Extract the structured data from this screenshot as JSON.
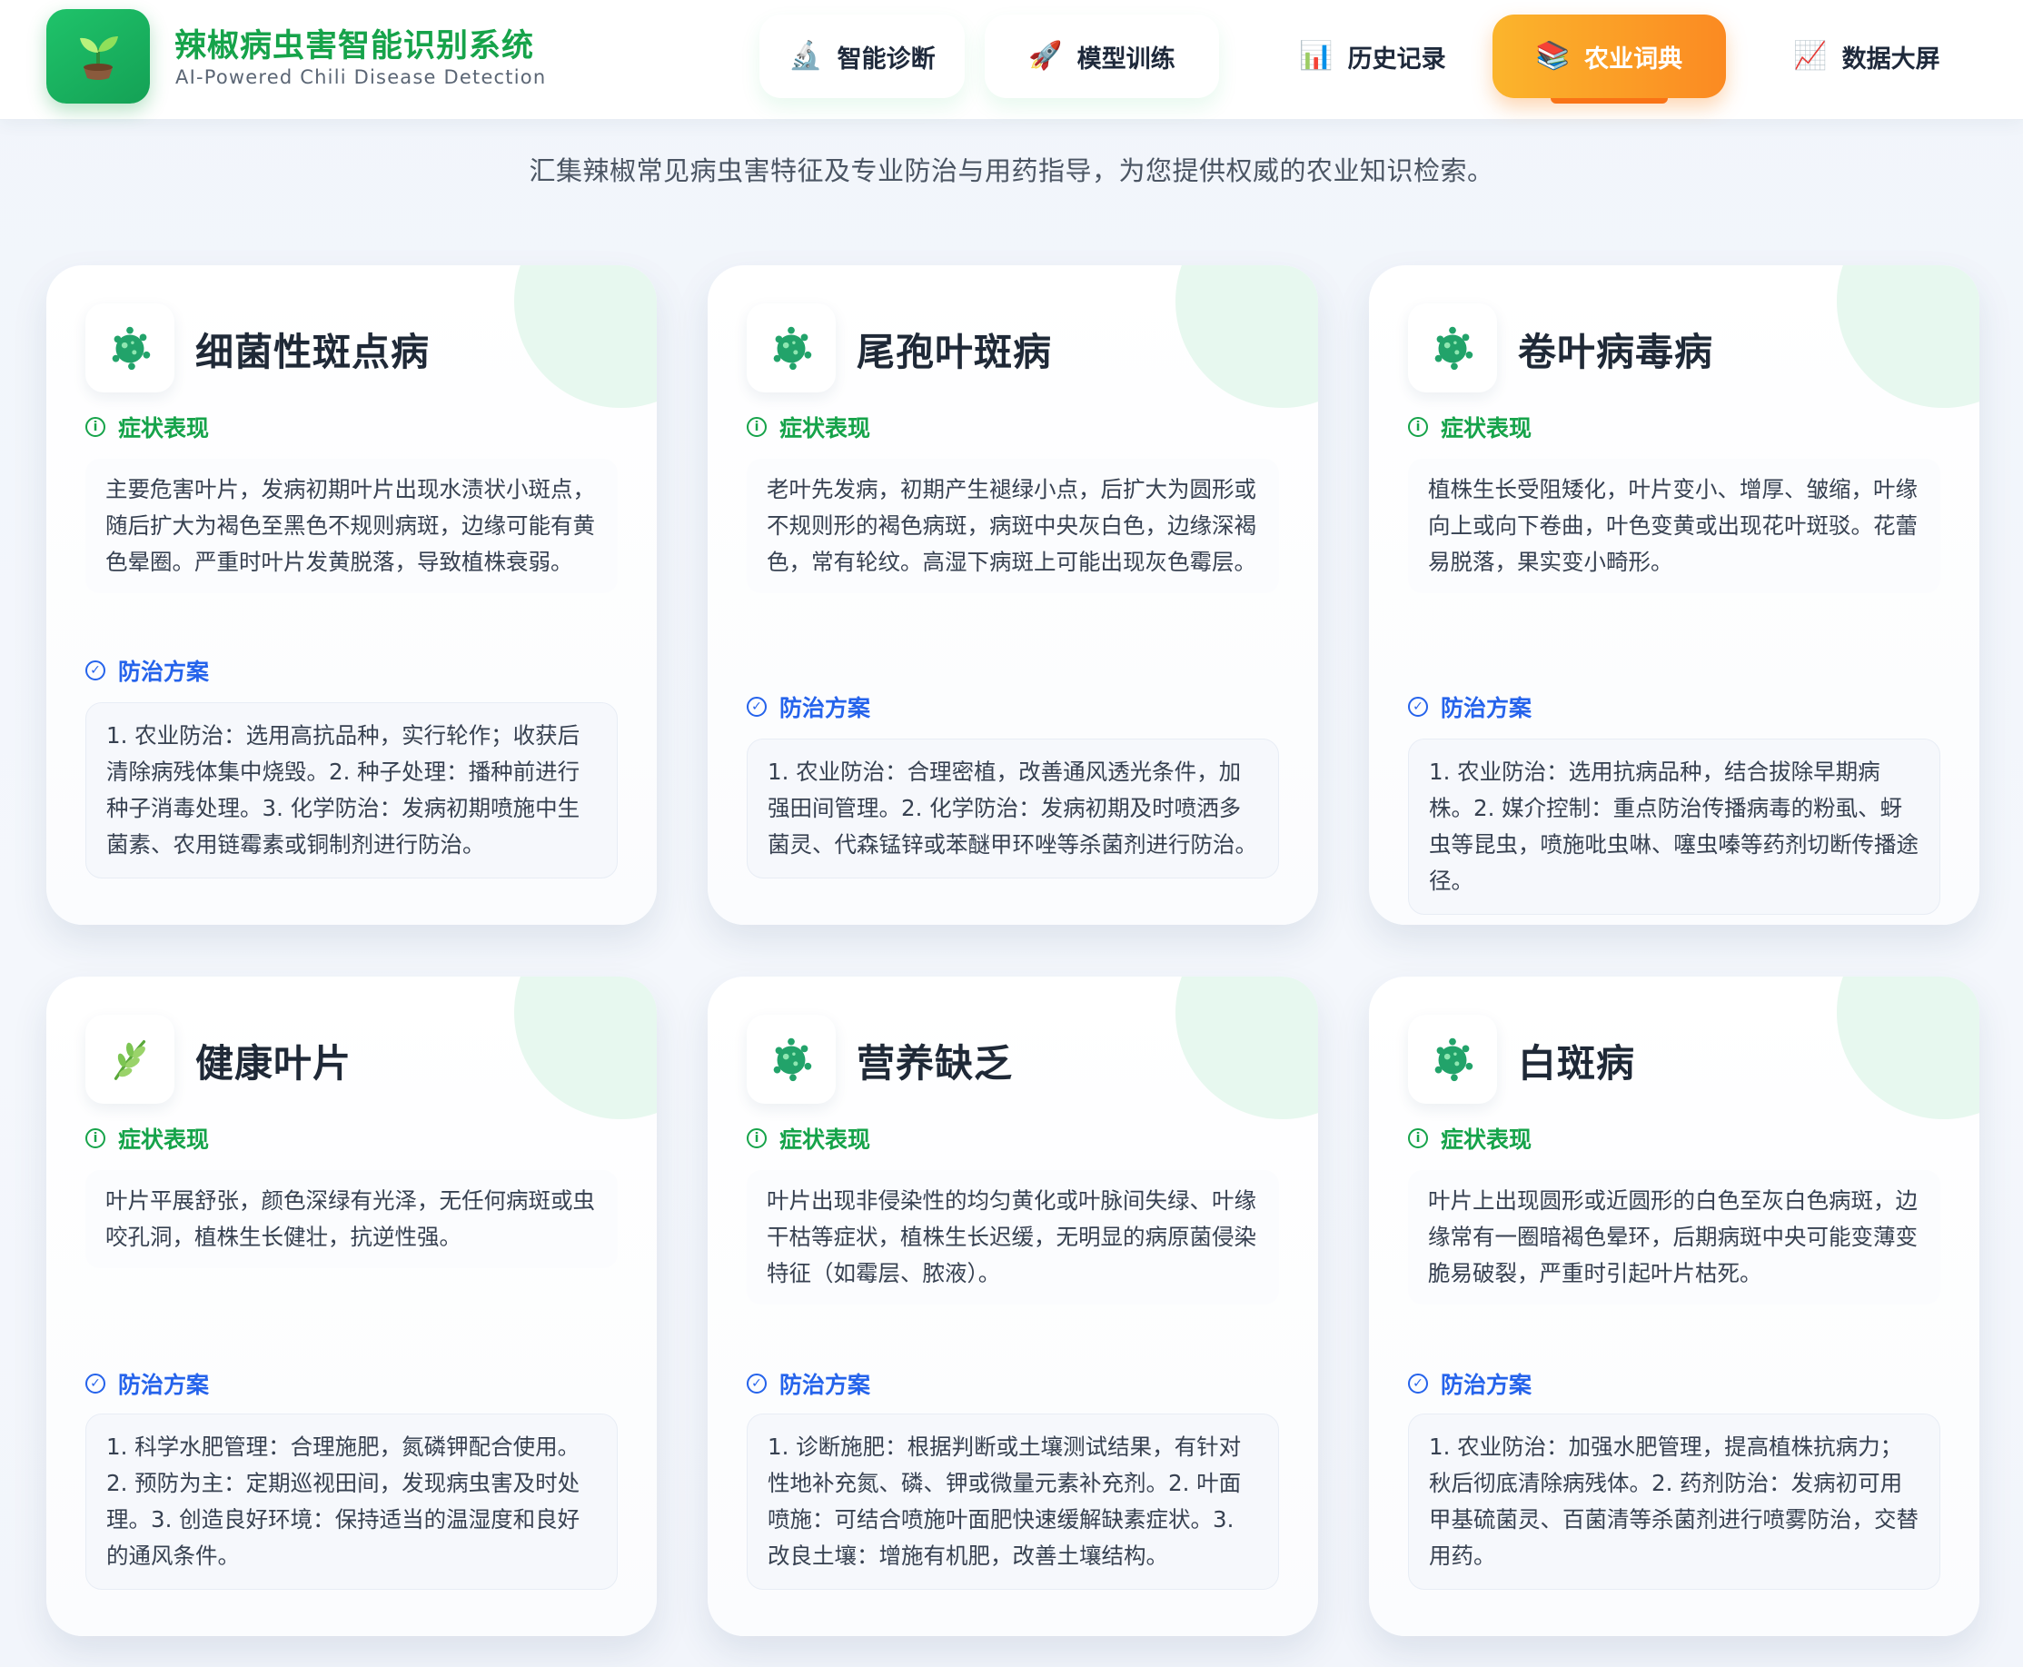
{
  "app": {
    "title": "辣椒病虫害智能识别系统",
    "subtitle": "AI-Powered Chili Disease Detection",
    "logo_icon": "seedling-icon",
    "brand_color": "#16a34a"
  },
  "nav": {
    "items": [
      {
        "label": "智能诊断",
        "icon": "microscope-icon",
        "glyph": "🔬",
        "active": false
      },
      {
        "label": "模型训练",
        "icon": "rocket-icon",
        "glyph": "🚀",
        "active": false
      },
      {
        "label": "历史记录",
        "icon": "bar-chart-icon",
        "glyph": "📊",
        "active": false
      },
      {
        "label": "农业词典",
        "icon": "books-icon",
        "glyph": "📚",
        "active": true
      },
      {
        "label": "数据大屏",
        "icon": "line-chart-icon",
        "glyph": "📈",
        "active": false
      }
    ],
    "active_gradient": [
      "#fbb52c",
      "#fb8a22"
    ]
  },
  "intro": "汇集辣椒常见病虫害特征及专业防治与用药指导，为您提供权威的农业知识检索。",
  "labels": {
    "symptom": "症状表现",
    "treatment": "防治方案"
  },
  "cards": [
    {
      "title": "细菌性斑点病",
      "icon": "microbe-icon",
      "symptom": "主要危害叶片，发病初期叶片出现水渍状小斑点，随后扩大为褐色至黑色不规则病斑，边缘可能有黄色晕圈。严重时叶片发黄脱落，导致植株衰弱。",
      "treatment": "1. 农业防治：选用高抗品种，实行轮作；收获后清除病残体集中烧毁。2. 种子处理：播种前进行种子消毒处理。3. 化学防治：发病初期喷施中生菌素、农用链霉素或铜制剂进行防治。"
    },
    {
      "title": "尾孢叶斑病",
      "icon": "microbe-icon",
      "symptom": "老叶先发病，初期产生褪绿小点，后扩大为圆形或不规则形的褐色病斑，病斑中央灰白色，边缘深褐色，常有轮纹。高湿下病斑上可能出现灰色霉层。",
      "treatment": "1. 农业防治：合理密植，改善通风透光条件，加强田间管理。2. 化学防治：发病初期及时喷洒多菌灵、代森锰锌或苯醚甲环唑等杀菌剂进行防治。"
    },
    {
      "title": "卷叶病毒病",
      "icon": "microbe-icon",
      "symptom": "植株生长受阻矮化，叶片变小、增厚、皱缩，叶缘向上或向下卷曲，叶色变黄或出现花叶斑驳。花蕾易脱落，果实变小畸形。",
      "treatment": "1. 农业防治：选用抗病品种，结合拔除早期病株。2. 媒介控制：重点防治传播病毒的粉虱、蚜虫等昆虫，喷施吡虫啉、噻虫嗪等药剂切断传播途径。"
    },
    {
      "title": "健康叶片",
      "icon": "herb-icon",
      "symptom": "叶片平展舒张，颜色深绿有光泽，无任何病斑或虫咬孔洞，植株生长健壮，抗逆性强。",
      "treatment": "1. 科学水肥管理：合理施肥，氮磷钾配合使用。2. 预防为主：定期巡视田间，发现病虫害及时处理。3. 创造良好环境：保持适当的温湿度和良好的通风条件。"
    },
    {
      "title": "营养缺乏",
      "icon": "microbe-icon",
      "symptom": "叶片出现非侵染性的均匀黄化或叶脉间失绿、叶缘干枯等症状，植株生长迟缓，无明显的病原菌侵染特征（如霉层、脓液）。",
      "treatment": "1. 诊断施肥：根据判断或土壤测试结果，有针对性地补充氮、磷、钾或微量元素补充剂。2. 叶面喷施：可结合喷施叶面肥快速缓解缺素症状。3. 改良土壤：增施有机肥，改善土壤结构。"
    },
    {
      "title": "白斑病",
      "icon": "microbe-icon",
      "symptom": "叶片上出现圆形或近圆形的白色至灰白色病斑，边缘常有一圈暗褐色晕环，后期病斑中央可能变薄变脆易破裂，严重时引起叶片枯死。",
      "treatment": "1. 农业防治：加强水肥管理，提高植株抗病力；秋后彻底清除病残体。2. 药剂防治：发病初可用甲基硫菌灵、百菌清等杀菌剂进行喷雾防治，交替用药。"
    }
  ]
}
